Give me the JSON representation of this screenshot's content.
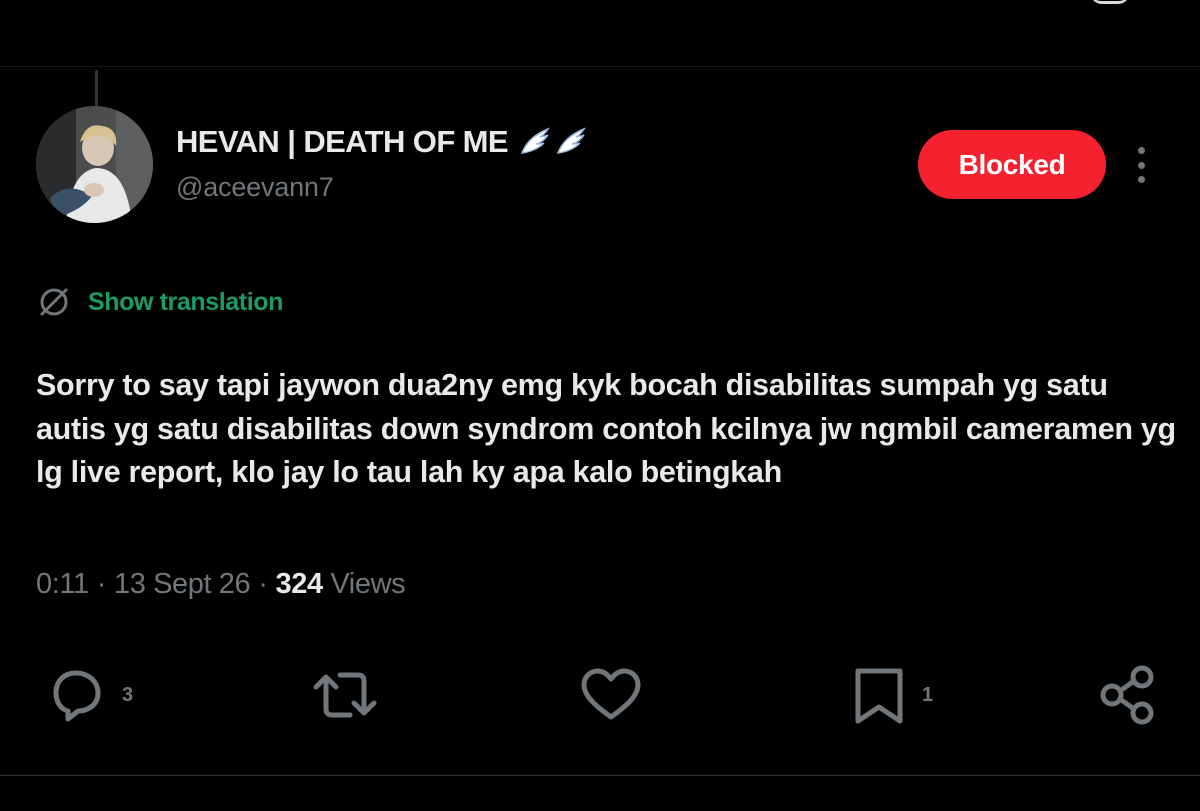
{
  "author": {
    "display_name": "HEVAN | DEATH OF ME",
    "handle": "@aceevann7",
    "avatar": "user-avatar-photo",
    "name_emoji": "wing-icon"
  },
  "header": {
    "blocked_label": "Blocked",
    "more_icon": "more-vertical-icon"
  },
  "translation": {
    "icon": "globe-icon",
    "label": "Show translation"
  },
  "tweet": {
    "text": "Sorry to say tapi jaywon dua2ny emg kyk bocah disabilitas sumpah yg satu autis yg satu disabilitas down syndrom contoh kcilnya jw ngmbil cameramen yg lg live report, klo jay lo tau lah ky apa kalo betingkah",
    "time": "0:11",
    "date": "13 Sept 26",
    "views_count": "324",
    "views_label": "Views",
    "separator": "·"
  },
  "actions": {
    "reply": {
      "icon": "reply-icon",
      "count": "3"
    },
    "retweet": {
      "icon": "retweet-icon",
      "count": ""
    },
    "like": {
      "icon": "heart-icon",
      "count": ""
    },
    "bookmark": {
      "icon": "bookmark-icon",
      "count": "1"
    },
    "share": {
      "icon": "share-icon"
    }
  },
  "colors": {
    "background": "#000000",
    "primary_text": "#e7e9ea",
    "secondary_text": "#71767b",
    "blocked_button": "#f4212e",
    "translation_link": "#1a9c64"
  }
}
